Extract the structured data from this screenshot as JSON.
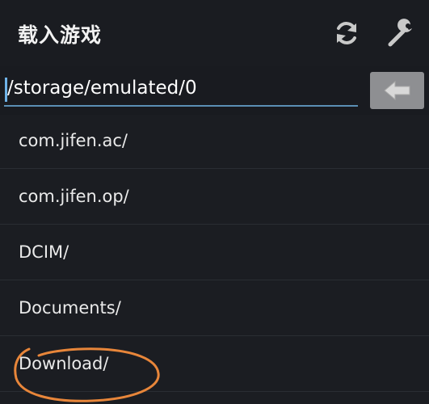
{
  "header": {
    "title": "载入游戏",
    "refresh_icon": "refresh-icon",
    "settings_icon": "wrench-icon"
  },
  "path_bar": {
    "value": "/storage/emulated/0",
    "back_icon": "arrow-left-icon"
  },
  "files": [
    {
      "name": "com.jifen.ac/"
    },
    {
      "name": "com.jifen.op/"
    },
    {
      "name": "DCIM/"
    },
    {
      "name": "Documents/"
    },
    {
      "name": "Download/"
    }
  ],
  "colors": {
    "background": "#1b1d22",
    "accent_underline": "#5b8fb4",
    "annotation": "#e8863a",
    "back_button": "#8e8f92"
  }
}
